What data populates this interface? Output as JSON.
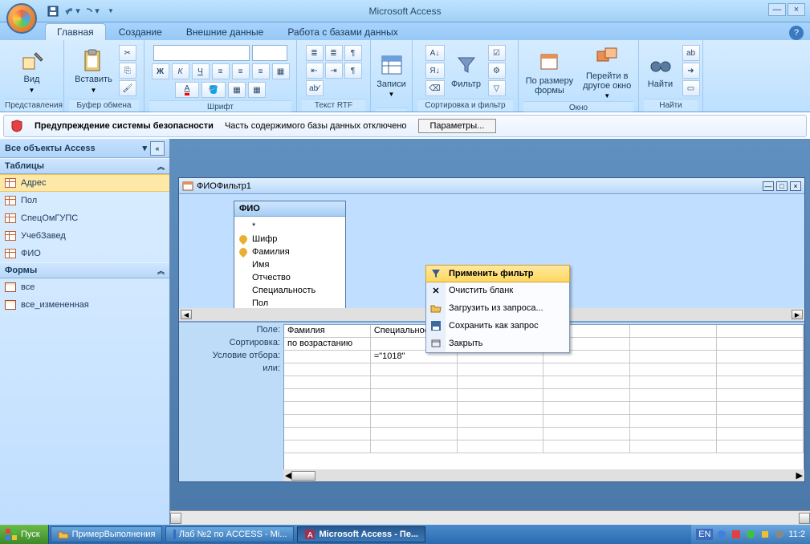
{
  "app": {
    "title": "Microsoft Access"
  },
  "tabs": {
    "t1": "Главная",
    "t2": "Создание",
    "t3": "Внешние данные",
    "t4": "Работа с базами данных"
  },
  "ribbon": {
    "g1": {
      "label": "Представления",
      "btn": "Вид"
    },
    "g2": {
      "label": "Буфер обмена",
      "btn": "Вставить"
    },
    "g3": {
      "label": "Шрифт"
    },
    "g4": {
      "label": "Текст RTF"
    },
    "g5": {
      "label": "",
      "btn": "Записи"
    },
    "g6": {
      "label": "Сортировка и фильтр",
      "btn": "Фильтр"
    },
    "g7": {
      "label": "Окно",
      "b1": "По размеру\nформы",
      "b2": "Перейти в\nдругое окно"
    },
    "g8": {
      "label": "Найти",
      "btn": "Найти"
    }
  },
  "security": {
    "title": "Предупреждение системы безопасности",
    "msg": "Часть содержимого базы данных отключено",
    "btn": "Параметры..."
  },
  "nav": {
    "header": "Все объекты Access",
    "cat1": "Таблицы",
    "items1": [
      "Адрес",
      "Пол",
      "СпецОмГУПС",
      "УчебЗавед",
      "ФИО"
    ],
    "cat2": "Формы",
    "items2": [
      "все",
      "все_измененная"
    ]
  },
  "filterwin": {
    "title": "ФИОФильтр1",
    "table": "ФИО",
    "fields": {
      "star": "*",
      "f1": "Шифр",
      "f2": "Фамилия",
      "f3": "Имя",
      "f4": "Отчество",
      "f5": "Специальность",
      "f6": "Пол"
    },
    "gridlabels": {
      "l1": "Поле:",
      "l2": "Сортировка:",
      "l3": "Условие отбора:",
      "l4": "или:"
    },
    "gridvals": {
      "c1": "Фамилия",
      "c2": "Специальность",
      "s1": "по возрастанию",
      "cr1": "=\"1018\""
    }
  },
  "ctx": {
    "i1": "Применить фильтр",
    "i2": "Очистить бланк",
    "i3": "Загрузить из запроса...",
    "i4": "Сохранить как запрос",
    "i5": "Закрыть"
  },
  "taskbar": {
    "start": "Пуск",
    "t1": "ПримерВыполнения",
    "t2": "Лаб №2 по ACCESS - Mi...",
    "t3": "Microsoft Access - Пе...",
    "lang": "EN",
    "time": "11:2"
  }
}
